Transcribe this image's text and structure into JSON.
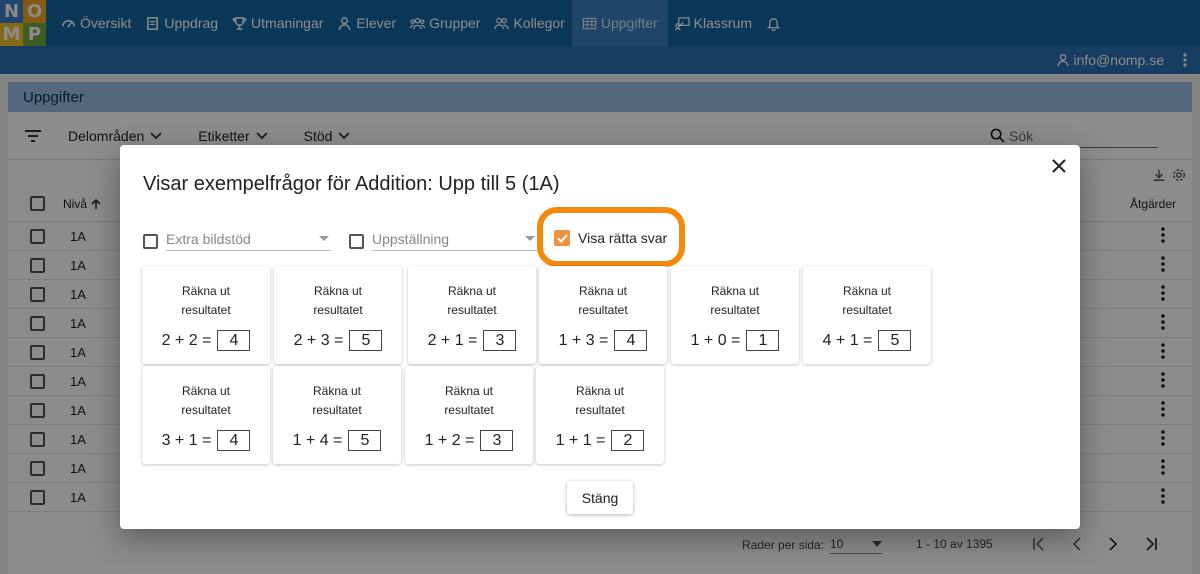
{
  "logo": {
    "letters": [
      "N",
      "O",
      "M",
      "P"
    ]
  },
  "nav": {
    "items": [
      {
        "label": "Översikt",
        "icon": "dashboard-icon"
      },
      {
        "label": "Uppdrag",
        "icon": "assignment-icon"
      },
      {
        "label": "Utmaningar",
        "icon": "trophy-icon"
      },
      {
        "label": "Elever",
        "icon": "person-icon"
      },
      {
        "label": "Grupper",
        "icon": "group-icon"
      },
      {
        "label": "Kollegor",
        "icon": "colleagues-icon"
      },
      {
        "label": "Uppgifter",
        "icon": "table-icon",
        "active": true
      },
      {
        "label": "Klassrum",
        "icon": "classroom-icon"
      }
    ],
    "bell_icon": "bell-icon"
  },
  "user": {
    "email": "info@nomp.se"
  },
  "page": {
    "title": "Uppgifter",
    "filters": [
      "Delområden",
      "Etiketter",
      "Stöd"
    ],
    "search_placeholder": "Sök",
    "table": {
      "header_level": "Nivå",
      "header_actions": "Åtgärder",
      "rows": [
        "1A",
        "1A",
        "1A",
        "1A",
        "1A",
        "1A",
        "1A",
        "1A",
        "1A",
        "1A"
      ]
    },
    "pager": {
      "rows_per_page_label": "Rader per sida:",
      "rows_per_page_value": "10",
      "range": "1 - 10 av 1395"
    }
  },
  "dialog": {
    "title": "Visar exempelfrågor för Addition: Upp till 5 (1A)",
    "options": {
      "extra_support": {
        "checked": false,
        "placeholder": "Extra bildstöd"
      },
      "layout": {
        "checked": false,
        "placeholder": "Uppställning"
      },
      "show_answers": {
        "checked": true,
        "label": "Visa rätta svar"
      }
    },
    "cards": [
      {
        "line1": "Räkna ut",
        "line2": "resultatet",
        "expr": "2 + 2 =",
        "answer": "4"
      },
      {
        "line1": "Räkna ut",
        "line2": "resultatet",
        "expr": "2 + 3 =",
        "answer": "5"
      },
      {
        "line1": "Räkna ut",
        "line2": "resultatet",
        "expr": "2 + 1 =",
        "answer": "3"
      },
      {
        "line1": "Räkna ut",
        "line2": "resultatet",
        "expr": "1 + 3 =",
        "answer": "4"
      },
      {
        "line1": "Räkna ut",
        "line2": "resultatet",
        "expr": "1 + 0 =",
        "answer": "1"
      },
      {
        "line1": "Räkna ut",
        "line2": "resultatet",
        "expr": "4 + 1 =",
        "answer": "5"
      },
      {
        "line1": "Räkna ut",
        "line2": "resultatet",
        "expr": "3 + 1 =",
        "answer": "4"
      },
      {
        "line1": "Räkna ut",
        "line2": "resultatet",
        "expr": "1 + 4 =",
        "answer": "5"
      },
      {
        "line1": "Räkna ut",
        "line2": "resultatet",
        "expr": "1 + 2 =",
        "answer": "3"
      },
      {
        "line1": "Räkna ut",
        "line2": "resultatet",
        "expr": "1 + 1 =",
        "answer": "2"
      }
    ],
    "close_label": "Stäng"
  },
  "colors": {
    "nav_bg": "#1565a0",
    "nav_active": "#3a7fbd",
    "highlight_ring": "#f5890c",
    "checkbox_checked": "#f09340"
  }
}
